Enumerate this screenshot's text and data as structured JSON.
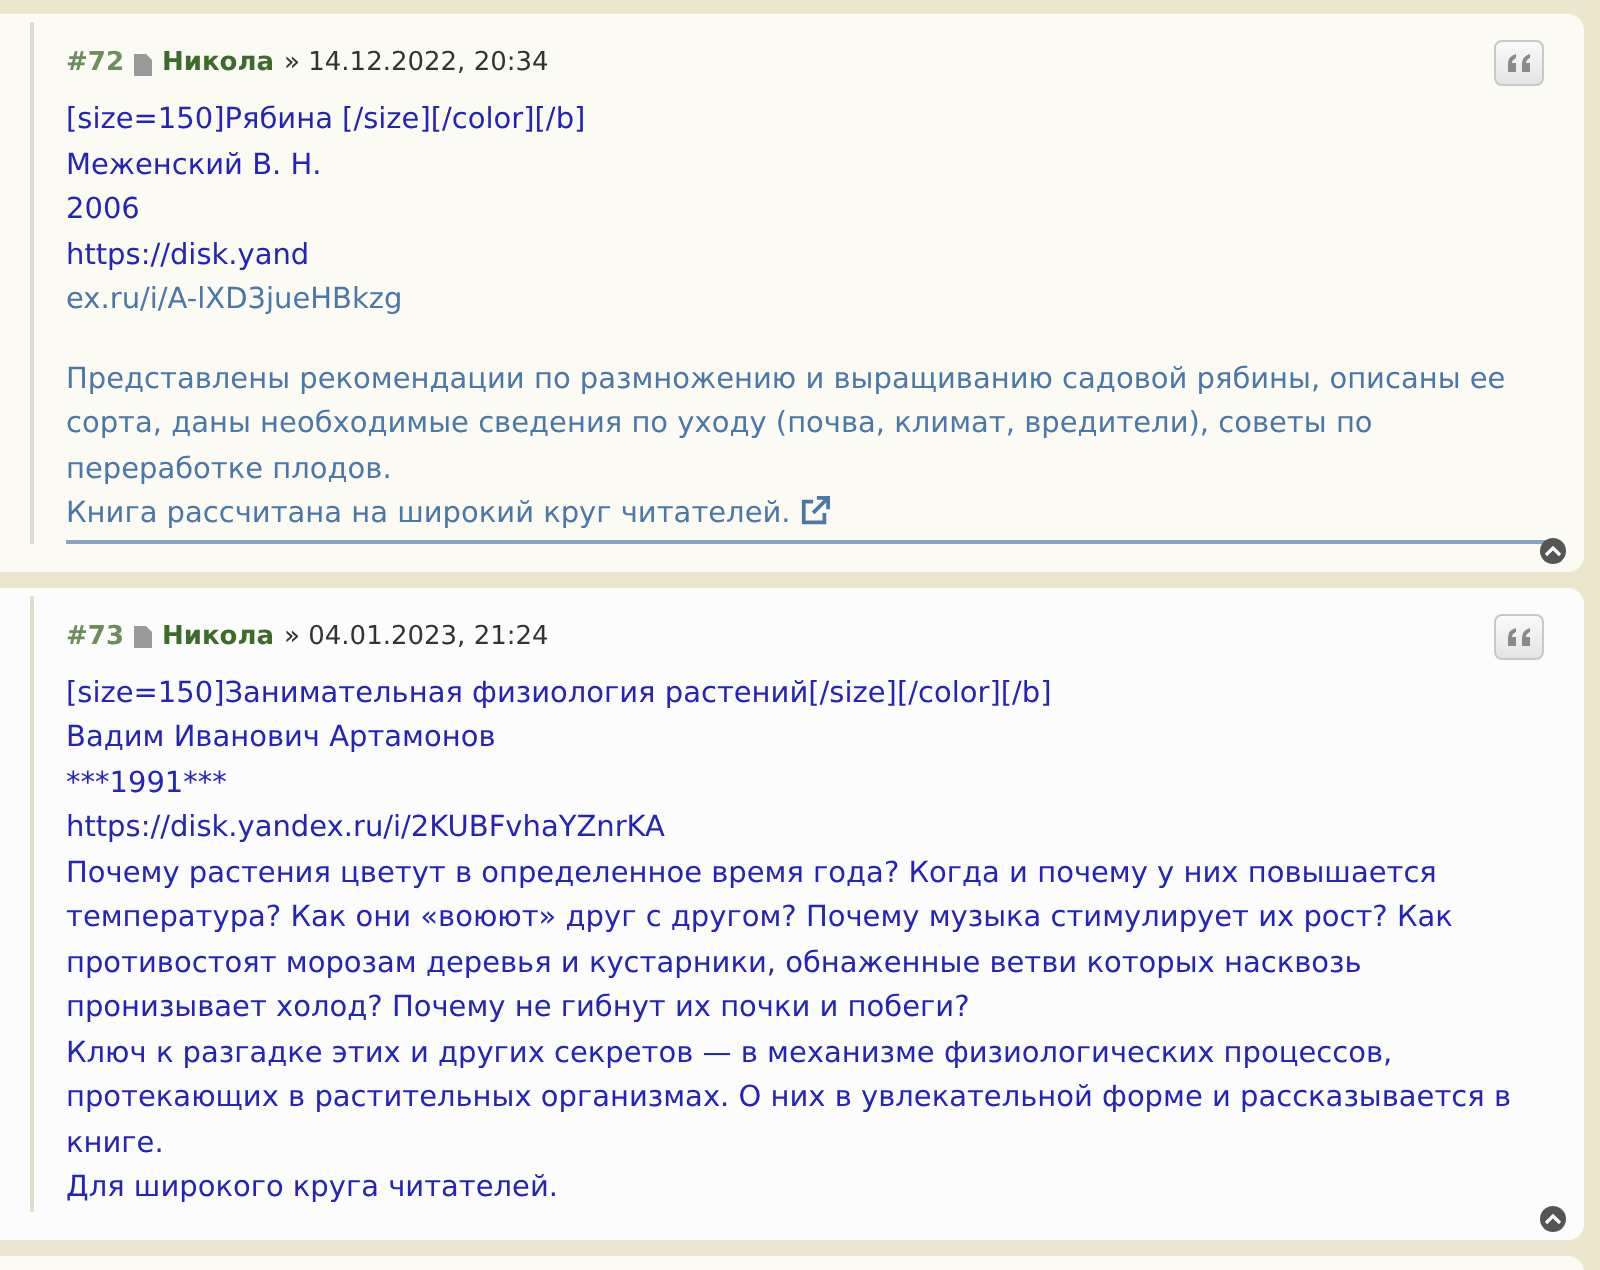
{
  "posts": [
    {
      "number": "#72",
      "author": "Никола",
      "separator": "»",
      "datetime": "14.12.2022, 20:34",
      "blocks": [
        {
          "kind": "text",
          "text": "[size=150]Рябина [/size][/color][/b]"
        },
        {
          "kind": "text",
          "text": "Меженский В. Н."
        },
        {
          "kind": "text",
          "text": "2006"
        },
        {
          "kind": "text",
          "text": "https://disk.yand"
        },
        {
          "kind": "link",
          "paragraphs": [
            "ex.ru/i/A-lXD3jueHBkzg",
            "Представлены рекомендации по размножению и выращиванию садовой рябины, описаны ее сорта, даны необходимые сведения по уходу (почва, климат, вредители), советы по переработке плодов.",
            "Книга рассчитана на широкий круг читателей."
          ],
          "external": true
        }
      ]
    },
    {
      "number": "#73",
      "author": "Никола",
      "separator": "»",
      "datetime": "04.01.2023, 21:24",
      "blocks": [
        {
          "kind": "text",
          "text": "[size=150]Занимательная физиология растений[/size][/color][/b]"
        },
        {
          "kind": "text",
          "text": "Вадим Иванович Артамонов"
        },
        {
          "kind": "text",
          "text": "***1991***"
        },
        {
          "kind": "text",
          "text": "https://disk.yandex.ru/i/2KUBFvhaYZnrKA"
        },
        {
          "kind": "text",
          "text": "Почему растения цветут в определенное время года? Когда и почему у них повышается температура? Как они «воюют» друг с другом? Почему музыка стимулирует их рост? Как противостоят морозам деревья и кустарники, обнаженные ветви которых насквозь пронизывает холод? Почему не гибнут их почки и побеги?"
        },
        {
          "kind": "text",
          "text": "Ключ к разгадке этих и других секретов — в механизме физиологических процессов, протекающих в растительных организмах. О них в увлекательной форме и рассказывается в книге."
        },
        {
          "kind": "text",
          "text": "Для широкого круга читателей."
        }
      ]
    }
  ]
}
